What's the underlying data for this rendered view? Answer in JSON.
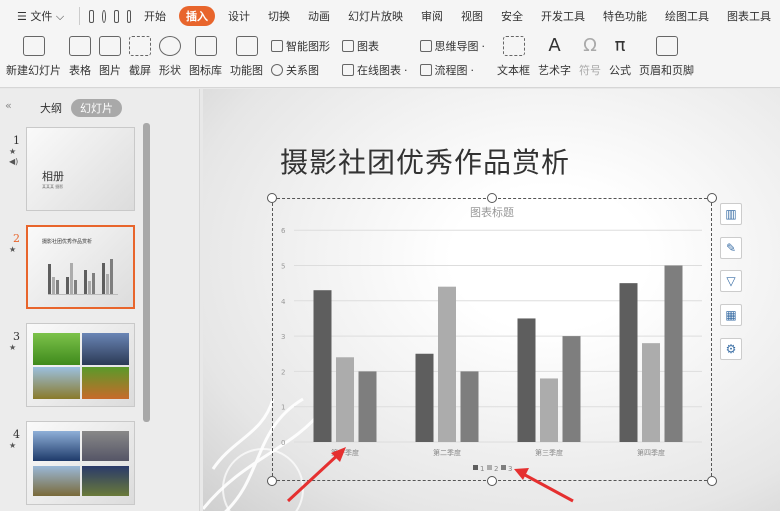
{
  "menubar": {
    "file": "文件",
    "items": [
      "开始",
      "插入",
      "设计",
      "切换",
      "动画",
      "幻灯片放映",
      "审阅",
      "视图",
      "安全",
      "开发工具",
      "特色功能",
      "绘图工具",
      "图表工具"
    ],
    "active": "插入"
  },
  "ribbon": {
    "new_slide": "新建幻灯片",
    "table": "表格",
    "picture": "图片",
    "screenshot": "截屏",
    "shape": "形状",
    "icon_lib": "图标库",
    "function_chart": "功能图",
    "smart_art": "智能图形",
    "relation": "关系图",
    "chart": "图表",
    "online_chart": "在线图表",
    "mindmap": "思维导图",
    "flowchart": "流程图",
    "textbox": "文本框",
    "wordart": "艺术字",
    "symbol": "符号",
    "formula": "公式",
    "header_footer": "页眉和页脚"
  },
  "panel": {
    "tab_outline": "大纲",
    "tab_slides": "幻灯片",
    "slides": [
      {
        "num": "1",
        "title": "相册",
        "subtitle": "某某某 摄影"
      },
      {
        "num": "2",
        "title": "摄影社团优秀作品赏析"
      },
      {
        "num": "3"
      },
      {
        "num": "4"
      }
    ]
  },
  "slide": {
    "title": "摄影社团优秀作品赏析"
  },
  "accent": "#e8652c",
  "chart_data": {
    "type": "bar",
    "title": "图表标题",
    "categories": [
      "第一季度",
      "第二季度",
      "第三季度",
      "第四季度"
    ],
    "series": [
      {
        "name": "1",
        "values": [
          4.3,
          2.5,
          3.5,
          4.5
        ],
        "color": "#5e5e5e"
      },
      {
        "name": "2",
        "values": [
          2.4,
          4.4,
          1.8,
          2.8
        ],
        "color": "#acacac"
      },
      {
        "name": "3",
        "values": [
          2.0,
          2.0,
          3.0,
          5.0
        ],
        "color": "#7e7e7e"
      }
    ],
    "ylim": [
      0,
      6
    ],
    "yticks": [
      "0",
      "1",
      "2",
      "3",
      "4",
      "5",
      "6"
    ],
    "grid": true,
    "legend": "bottom"
  }
}
